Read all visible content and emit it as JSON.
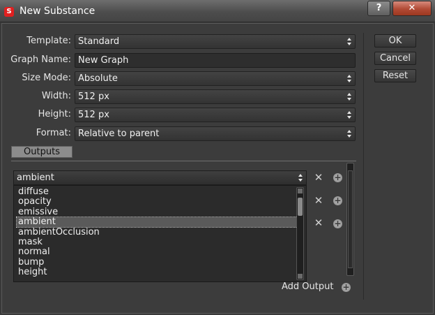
{
  "window": {
    "title": "New Substance",
    "app_icon": "S",
    "help_label": "?",
    "close_label": "✕"
  },
  "form": {
    "template": {
      "label": "Template:",
      "value": "Standard"
    },
    "graph_name": {
      "label": "Graph Name:",
      "value": "New Graph"
    },
    "size_mode": {
      "label": "Size Mode:",
      "value": "Absolute"
    },
    "width": {
      "label": "Width:",
      "value": "512 px"
    },
    "height": {
      "label": "Height:",
      "value": "512 px"
    },
    "format": {
      "label": "Format:",
      "value": "Relative to parent"
    }
  },
  "buttons": {
    "ok": "OK",
    "cancel": "Cancel",
    "reset": "Reset"
  },
  "outputs": {
    "tab_label": "Outputs",
    "current": "ambient",
    "options": [
      "diffuse",
      "opacity",
      "emissive",
      "ambient",
      "ambientOcclusion",
      "mask",
      "normal",
      "bump",
      "height"
    ],
    "selected_index": 3,
    "add_label": "Add Output"
  },
  "icons": {
    "remove": "x-icon",
    "add": "plus-circle-icon",
    "spin": "up-down-arrows-icon"
  },
  "colors": {
    "close_button": "#b14a35",
    "background": "#3c3c3c",
    "tab": "#8c8c8c"
  }
}
